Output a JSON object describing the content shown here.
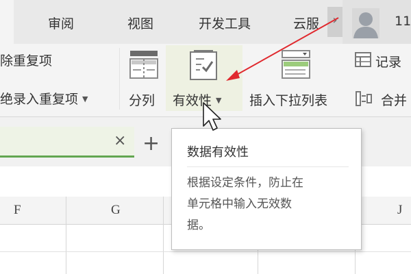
{
  "tabs": [
    {
      "label": "审阅"
    },
    {
      "label": "视图"
    },
    {
      "label": "开发工具"
    },
    {
      "label": "云服"
    }
  ],
  "tab_more": "›",
  "user": {
    "name": "11"
  },
  "ribbon": {
    "remove_duplicates": "除重复项",
    "reject_duplicates": "绝录入重复项",
    "split_column": "分列",
    "validity": "有效性",
    "insert_dropdown": "插入下拉列表",
    "record": "记录",
    "merge": "合并"
  },
  "sheet": {
    "close_glyph": "×",
    "add_glyph": "+",
    "accent": "#62a650"
  },
  "columns": [
    "F",
    "G",
    "J"
  ],
  "tooltip": {
    "title": "数据有效性",
    "line1": "根据设定条件，防止在",
    "line2": "单元格中输入无效数",
    "line3": "据。"
  },
  "annotation_color": "#e0292e"
}
